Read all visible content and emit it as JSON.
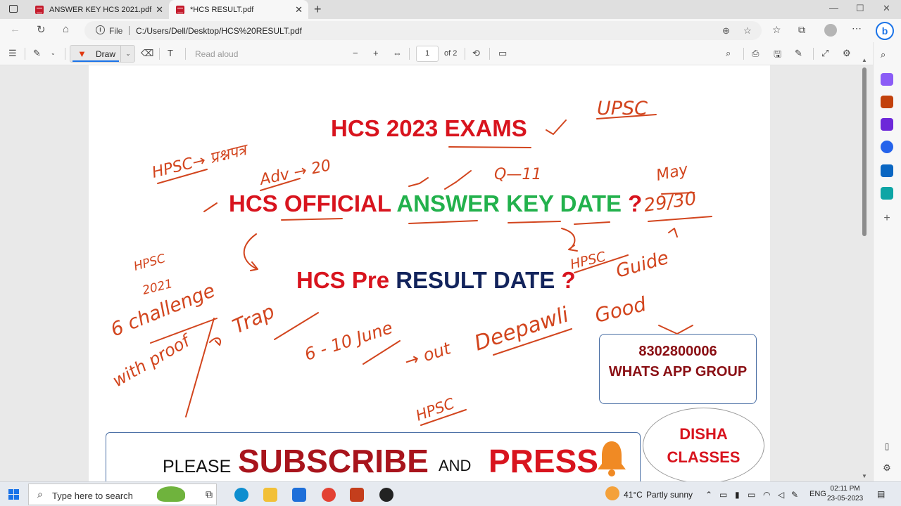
{
  "browser": {
    "tabs": [
      {
        "label": "ANSWER KEY HCS 2021.pdf",
        "active": false
      },
      {
        "label": "*HCS RESULT.pdf",
        "active": true
      }
    ],
    "address": {
      "scheme_label": "File",
      "url": "C:/Users/Dell/Desktop/HCS%20RESULT.pdf"
    }
  },
  "pdf_toolbar": {
    "draw_label": "Draw",
    "read_aloud_label": "Read aloud",
    "current_page": "1",
    "page_total_label": "of 2"
  },
  "document": {
    "headline_exams_part1": "HCS 2023 ",
    "headline_exams_part2": "EXAMS",
    "answer_key_part1": "HCS OFFICIAL ",
    "answer_key_part2": "ANSWER KEY DATE",
    "answer_key_q": " ?",
    "result_part1": "HCS Pre ",
    "result_part2": "RESULT DATE",
    "result_q": " ?",
    "phone_number": "8302800006",
    "whatsapp_group": "WHATS APP GROUP",
    "brand_line1": "DISHA",
    "brand_line2": "CLASSES",
    "cta_please": "PLEASE",
    "cta_subscribe": "SUBSCRIBE",
    "cta_and": "AND",
    "cta_press": "PRESS"
  },
  "handwriting": {
    "upsc": "UPSC",
    "hpsc_arrow": "HPSC→ प्रश्नपत्र",
    "adv": "Adv → 20",
    "q11": "Q—11",
    "may": "May",
    "date_range": "29/30",
    "hpsc_2021": "HPSC",
    "year_2021": "2021",
    "challenge": "6 challenge",
    "with_proof": "with proof",
    "trap": "Trap",
    "june": "6 - 10 June",
    "out": "→ out",
    "deepawali": "Deepawli",
    "hpsc_guide": "HPSC",
    "guide": "Guide",
    "good": "Good",
    "hpsc_bottom": "HPSC"
  },
  "taskbar": {
    "search_placeholder": "Type here to search",
    "weather_temp": "41°C",
    "weather_desc": "Partly sunny",
    "language": "ENG",
    "time": "02:11 PM",
    "date": "23-05-2023"
  },
  "colors": {
    "accent_red": "#d8141e",
    "accent_green": "#22b14c",
    "accent_navy": "#13245c",
    "ink": "#d2451e"
  }
}
